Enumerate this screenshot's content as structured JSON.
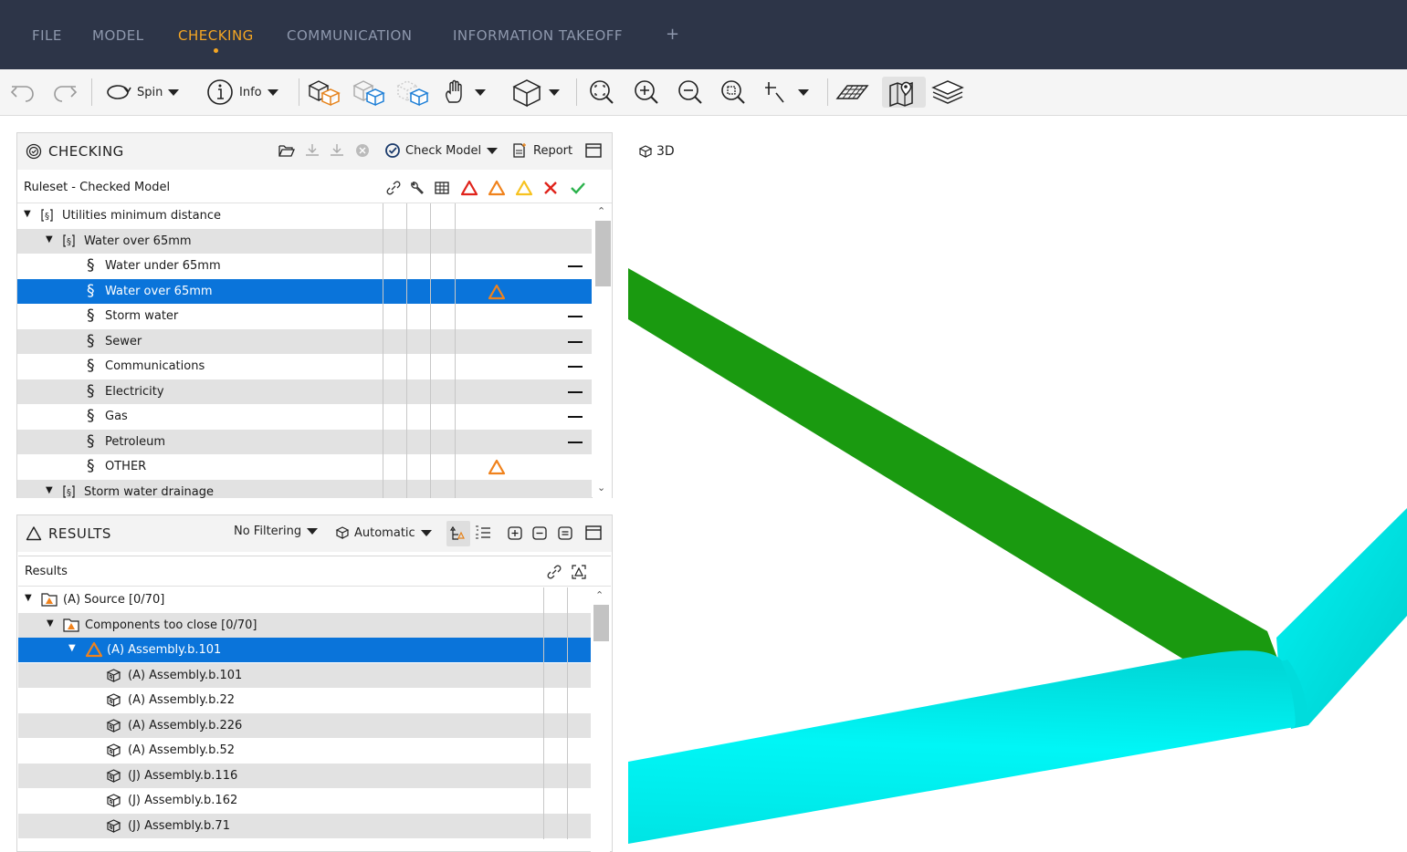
{
  "menu": {
    "items": [
      "FILE",
      "MODEL",
      "CHECKING",
      "COMMUNICATION",
      "INFORMATION TAKEOFF",
      "+"
    ],
    "active": "CHECKING"
  },
  "toolbar": {
    "spin_label": "Spin",
    "info_label": "Info"
  },
  "checking": {
    "title": "CHECKING",
    "check_model_label": "Check Model",
    "report_label": "Report",
    "column_header": "Ruleset - Checked Model",
    "rows": [
      {
        "label": "Utilities minimum distance",
        "level": 0,
        "type": "ruleset",
        "status": ""
      },
      {
        "label": "Water over 65mm",
        "level": 1,
        "type": "ruleset",
        "status": ""
      },
      {
        "label": "Water under 65mm",
        "level": 2,
        "type": "rule",
        "status": "none"
      },
      {
        "label": "Water over 65mm",
        "level": 2,
        "type": "rule",
        "status": "warning",
        "selected": true
      },
      {
        "label": "Storm water",
        "level": 2,
        "type": "rule",
        "status": "none"
      },
      {
        "label": "Sewer",
        "level": 2,
        "type": "rule",
        "status": "none"
      },
      {
        "label": "Communications",
        "level": 2,
        "type": "rule",
        "status": "none"
      },
      {
        "label": "Electricity",
        "level": 2,
        "type": "rule",
        "status": "none"
      },
      {
        "label": "Gas",
        "level": 2,
        "type": "rule",
        "status": "none"
      },
      {
        "label": "Petroleum",
        "level": 2,
        "type": "rule",
        "status": "none"
      },
      {
        "label": "OTHER",
        "level": 2,
        "type": "rule",
        "status": "warning"
      },
      {
        "label": "Storm water drainage",
        "level": 1,
        "type": "ruleset",
        "status": ""
      }
    ]
  },
  "results": {
    "title": "RESULTS",
    "filter_label": "No Filtering",
    "mode_label": "Automatic",
    "column_header": "Results",
    "rows": [
      {
        "label": "(A) Source [0/70]",
        "level": 0,
        "type": "folder"
      },
      {
        "label": "Components too close [0/70]",
        "level": 1,
        "type": "folder"
      },
      {
        "label": "(A) Assembly.b.101",
        "level": 2,
        "type": "issue",
        "selected": true
      },
      {
        "label": "(A) Assembly.b.101",
        "level": 3,
        "type": "component"
      },
      {
        "label": "(A) Assembly.b.22",
        "level": 3,
        "type": "component"
      },
      {
        "label": "(A) Assembly.b.226",
        "level": 3,
        "type": "component"
      },
      {
        "label": "(A) Assembly.b.52",
        "level": 3,
        "type": "component"
      },
      {
        "label": "(J) Assembly.b.116",
        "level": 3,
        "type": "component"
      },
      {
        "label": "(J) Assembly.b.162",
        "level": 3,
        "type": "component"
      },
      {
        "label": "(J) Assembly.b.71",
        "level": 3,
        "type": "component"
      }
    ]
  },
  "view": {
    "label": "3D"
  },
  "colors": {
    "menubar": "#2d3548",
    "accent": "#f5a623",
    "selection": "#0a74da",
    "pipe_green": "#22c41a",
    "pipe_cyan": "#00f2f2"
  }
}
